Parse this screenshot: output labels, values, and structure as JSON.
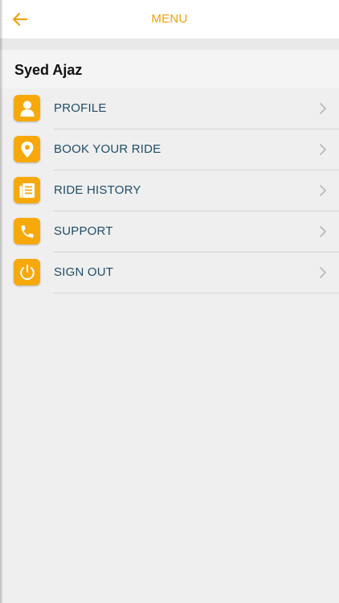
{
  "header": {
    "title": "MENU",
    "back_icon": "arrow-left-icon"
  },
  "user": {
    "name": "Syed Ajaz"
  },
  "menu": {
    "items": [
      {
        "label": "PROFILE",
        "icon": "user-icon"
      },
      {
        "label": "BOOK YOUR RIDE",
        "icon": "location-pin-icon"
      },
      {
        "label": "RIDE HISTORY",
        "icon": "list-document-icon"
      },
      {
        "label": "SUPPORT",
        "icon": "phone-icon"
      },
      {
        "label": "SIGN OUT",
        "icon": "power-icon"
      }
    ]
  },
  "colors": {
    "accent": "#f7a90b",
    "title": "#f0a20e",
    "label": "#1f4c68",
    "background": "#efefef"
  }
}
